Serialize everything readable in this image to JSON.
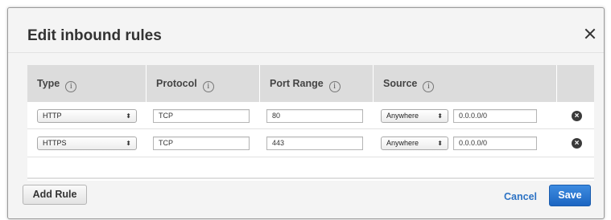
{
  "dialog": {
    "title": "Edit inbound rules",
    "close_glyph": "×"
  },
  "table": {
    "columns": [
      {
        "label": "Type",
        "info": "i"
      },
      {
        "label": "Protocol",
        "info": "i"
      },
      {
        "label": "Port Range",
        "info": "i"
      },
      {
        "label": "Source",
        "info": "i"
      }
    ],
    "rows": [
      {
        "type": "HTTP",
        "protocol": "TCP",
        "port_range": "80",
        "source_select": "Anywhere",
        "source_cidr": "0.0.0.0/0",
        "remove_icon": "remove-circle-icon"
      },
      {
        "type": "HTTPS",
        "protocol": "TCP",
        "port_range": "443",
        "source_select": "Anywhere",
        "source_cidr": "0.0.0.0/0",
        "remove_icon": "remove-circle-icon"
      }
    ]
  },
  "footer": {
    "add_rule_label": "Add Rule",
    "cancel_label": "Cancel",
    "save_label": "Save"
  },
  "colors": {
    "accent": "#2d73c4",
    "primary_button": "#1d66c2",
    "header_bg": "#dcdcdc"
  }
}
